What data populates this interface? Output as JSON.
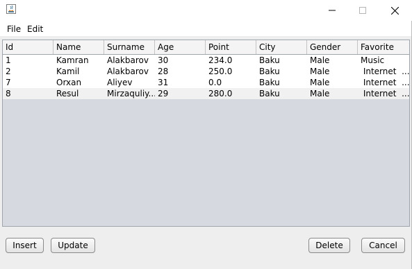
{
  "window": {
    "title": "",
    "controls": [
      "minimize",
      "maximize",
      "close"
    ]
  },
  "menu": [
    "File",
    "Edit"
  ],
  "table": {
    "columns": [
      "Id",
      "Name",
      "Surname",
      "Age",
      "Point",
      "City",
      "Gender",
      "Favorite"
    ],
    "rows": [
      [
        "1",
        "Kamran",
        "Alakbarov",
        "30",
        "234.0",
        "Baku",
        "Male",
        "Music"
      ],
      [
        "2",
        "Kamil",
        "Alakbarov",
        "28",
        "250.0",
        "Baku",
        "Male",
        " Internet  ..."
      ],
      [
        "7",
        "Orxan",
        "Aliyev",
        "31",
        "0.0",
        "Baku",
        "Male",
        " Internet  ..."
      ],
      [
        "8",
        "Resul",
        "Mirzaquliy...",
        "29",
        "280.0",
        "Baku",
        "Male",
        " Internet  ..."
      ]
    ]
  },
  "buttons": {
    "insert": "Insert",
    "update": "Update",
    "delete": "Delete",
    "cancel": "Cancel"
  }
}
